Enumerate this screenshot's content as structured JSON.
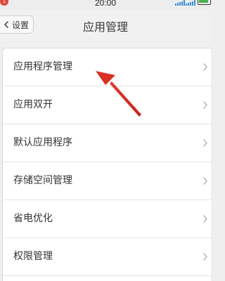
{
  "status_bar": {
    "time": "20:00",
    "notification_count": "1",
    "colors": {
      "badge": "#e0453a",
      "signal": "#3b8fd6",
      "battery": "#4db24d"
    }
  },
  "nav": {
    "back_label": "设置",
    "title": "应用管理"
  },
  "list": {
    "items": [
      {
        "label": "应用程序管理"
      },
      {
        "label": "应用双开"
      },
      {
        "label": "默认应用程序"
      },
      {
        "label": "存储空间管理"
      },
      {
        "label": "省电优化"
      },
      {
        "label": "权限管理"
      }
    ],
    "chevron_icon": "chevron-right-icon"
  },
  "annotation": {
    "type": "red-arrow",
    "color": "#d93025",
    "points_to": "应用程序管理"
  }
}
